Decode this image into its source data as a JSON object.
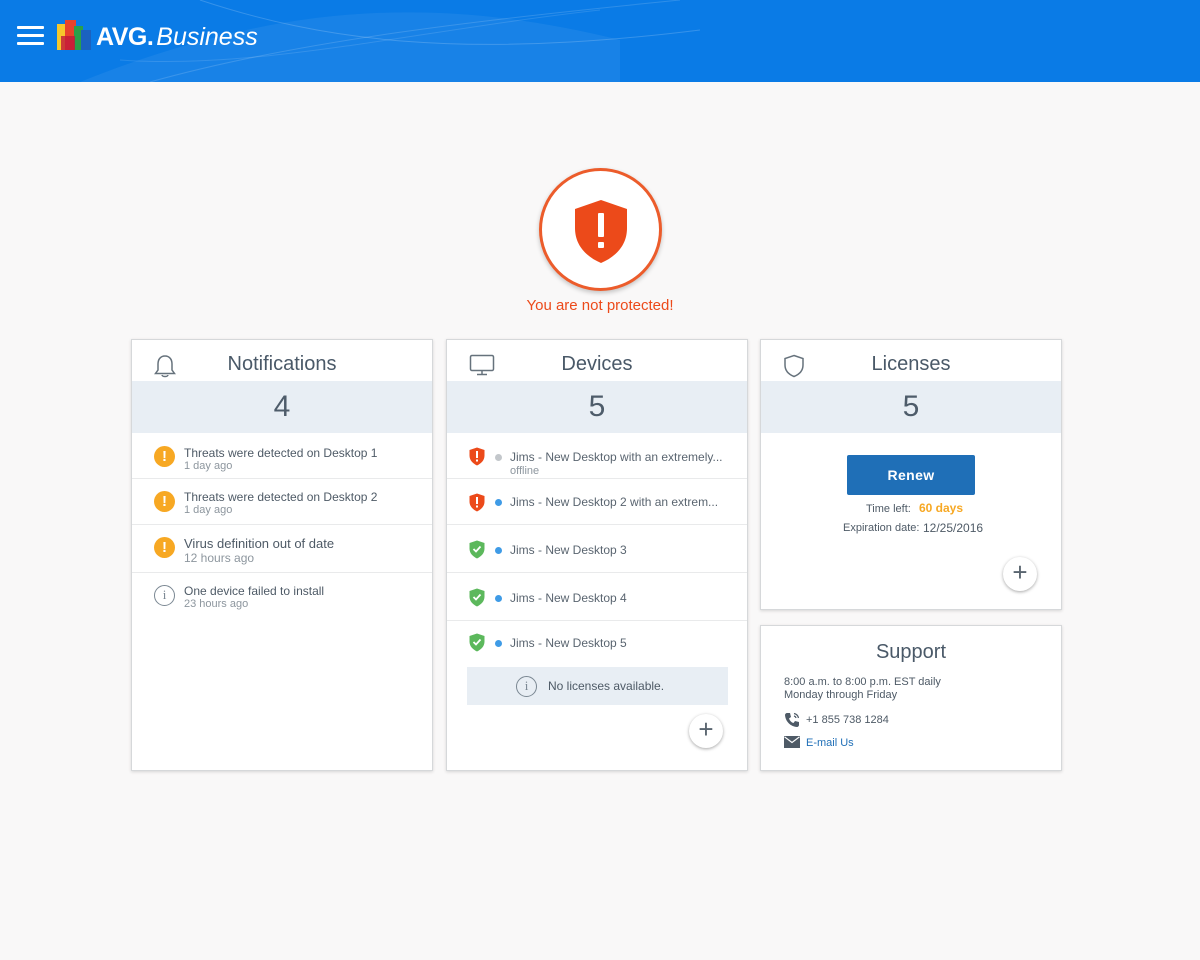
{
  "app": {
    "brand_bold": "AVG.",
    "brand_italic": "Business"
  },
  "colors": {
    "header": "#0a7be6",
    "alert": "#ec5c2b",
    "warning": "#f7a823",
    "safe": "#5cb85c",
    "online": "#3f9be6",
    "offline": "#c3c7cb",
    "button": "#1f6fb7"
  },
  "status": {
    "icon": "shield-alert-icon",
    "text": "You are not protected!"
  },
  "notifications": {
    "title": "Notifications",
    "icon": "bell-icon",
    "count": "4",
    "items": [
      {
        "type": "warning",
        "title": "Threats were detected on Desktop 1",
        "time": "1 day ago"
      },
      {
        "type": "warning",
        "title": "Threats were detected on Desktop 2",
        "time": "1 day ago"
      },
      {
        "type": "warning",
        "title": "Virus definition out of date",
        "time": "12 hours ago"
      },
      {
        "type": "info",
        "title": "One device failed to install",
        "time": "23 hours ago"
      }
    ]
  },
  "devices": {
    "title": "Devices",
    "icon": "monitor-icon",
    "count": "5",
    "items": [
      {
        "state": "alert",
        "online": false,
        "name": "Jims - New Desktop with an extremely...",
        "sub": "offline"
      },
      {
        "state": "alert",
        "online": true,
        "name": "Jims - New Desktop 2 with an extrem...",
        "sub": ""
      },
      {
        "state": "safe",
        "online": true,
        "name": "Jims - New  Desktop 3",
        "sub": ""
      },
      {
        "state": "safe",
        "online": true,
        "name": "Jims  - New Desktop 4",
        "sub": ""
      },
      {
        "state": "safe",
        "online": true,
        "name": "Jims  - New Desktop 5",
        "sub": ""
      }
    ],
    "no_licenses": "No licenses available.",
    "add_icon": "plus-icon"
  },
  "licenses": {
    "title": "Licenses",
    "icon": "shield-outline-icon",
    "count": "5",
    "renew_label": "Renew",
    "time_left_label": "Time left:",
    "time_left_value": "60 days",
    "expiration_label": "Expiration date:",
    "expiration_value": "12/25/2016",
    "add_icon": "plus-icon"
  },
  "support": {
    "title": "Support",
    "hours_line1": "8:00 a.m. to 8:00 p.m. EST daily",
    "hours_line2": "Monday through Friday",
    "phone": "+1 855 738 1284",
    "email_label": "E-mail Us"
  }
}
